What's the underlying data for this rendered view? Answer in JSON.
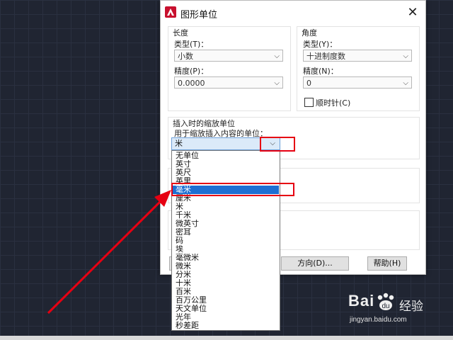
{
  "dialog": {
    "title": "图形单位",
    "close_glyph": "✕",
    "length": {
      "group_label": "长度",
      "type_label": "类型(T)：",
      "type_value": "小数",
      "precision_label": "精度(P)：",
      "precision_value": "0.0000"
    },
    "angle": {
      "group_label": "角度",
      "type_label": "类型(Y)：",
      "type_value": "十进制度数",
      "precision_label": "精度(N)：",
      "precision_value": "0",
      "clockwise_label": "顺时针(C)",
      "clockwise_checked": false
    },
    "insert_scale": {
      "group_label": "插入时的缩放单位",
      "prompt": "用于缩放插入内容的单位：",
      "selected_value": "米",
      "options": [
        "无单位",
        "英寸",
        "英尺",
        "英里",
        "毫米",
        "厘米",
        "米",
        "千米",
        "微英寸",
        "密耳",
        "码",
        "埃",
        "毫微米",
        "微米",
        "分米",
        "十米",
        "百米",
        "百万公里",
        "天文单位",
        "光年",
        "秒差距"
      ],
      "highlighted_option": "毫米"
    },
    "buttons": {
      "direction": "方向(D)...",
      "help": "帮助(H)"
    }
  },
  "watermark": {
    "logo_text": "Bai",
    "logo_suffix": "经验",
    "url": "jingyan.baidu.com"
  },
  "colors": {
    "annotation_red": "#e60012",
    "selection_blue": "#1e6fd2",
    "dialog_bg": "#ffffff",
    "canvas_bg": "#202532"
  },
  "icons": {
    "app": "autocad-logo-icon",
    "close": "close-icon",
    "dropdown": "chevron-down-icon",
    "annotation": "red-arrow-annotation"
  }
}
